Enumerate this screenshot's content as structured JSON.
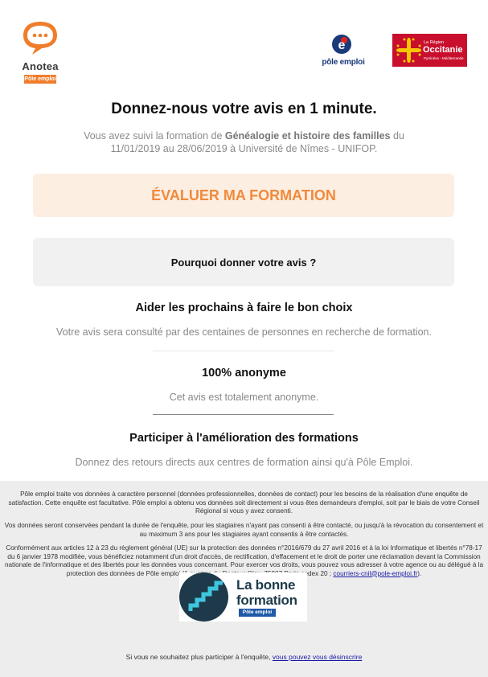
{
  "header": {
    "anotea_name": "Anotea",
    "anotea_tag": "Pôle emploi",
    "pole_emploi_text": "pôle emploi",
    "region_line1": "La Région",
    "region_line2": "Occitanie",
    "region_line3": "Pyrénées - Méditerranée"
  },
  "main": {
    "title": "Donnez-nous votre avis en 1 minute.",
    "intro_prefix": "Vous avez suivi la formation de ",
    "intro_course": "Généalogie et histoire des familles",
    "intro_suffix": " du 11/01/2019 au 28/06/2019 à Université de Nîmes - UNIFOP.",
    "cta_label": "ÉVALUER MA FORMATION",
    "why_label": "Pourquoi donner votre avis ?",
    "reasons": [
      {
        "title": "Aider les prochains à faire le bon choix",
        "text": "Votre avis sera consulté par des centaines de personnes en recherche de formation."
      },
      {
        "title": "100% anonyme",
        "text": "Cet avis est totalement anonyme."
      },
      {
        "title": "Participer à l'amélioration des formations",
        "text": "Donnez des retours directs aux centres de formation ainsi qu'à Pôle Emploi."
      }
    ]
  },
  "footer": {
    "legal1": "Pôle emploi traite vos données à caractère personnel (données professionnelles, données de contact) pour les besoins de la réalisation d'une enquête de satisfaction. Cette enquête est facultative. Pôle emploi a obtenu vos données soit directement si vous êtes demandeurs d'emploi, soit par le biais de votre Conseil Régional si vous y avez consenti.",
    "legal2": "Vos données seront conservées pendant la durée de l'enquête, pour les stagiaires n'ayant pas consenti à être contacté, ou jusqu'à la révocation du consentement et au maximum 3 ans pour les stagiaires ayant consentis à être contactés.",
    "legal3": "Conformément aux articles 12 à 23 du règlement général (UE) sur la protection des données n°2016/679 du 27 avril 2016 et à la loi Informatique et libertés n°78-17 du 6 janvier 1978 modifiée, vous bénéficiez notamment d'un droit d'accès, de rectification, d'effacement et le droit de porter une réclamation devant la Commission nationale de l'informatique et des libertés pour les données vous concernant. Pour exercer vos droits, vous pouvez vous adresser à votre agence ou au délégué à la protection des données de Pôle emploi (1 avenue du Docteur Gley, 75987 Paris cedex 20 ; ",
    "legal3_link": "courriers-cnil@pole-emploi.fr",
    "legal3_end": ").",
    "lbf_line1": "La bonne",
    "lbf_line2": "formation",
    "lbf_tag": "Pôle emploi",
    "unsub_text": "Si vous ne souhaitez plus participer à l'enquête, ",
    "unsub_link": "vous pouvez vous désinscrire"
  }
}
